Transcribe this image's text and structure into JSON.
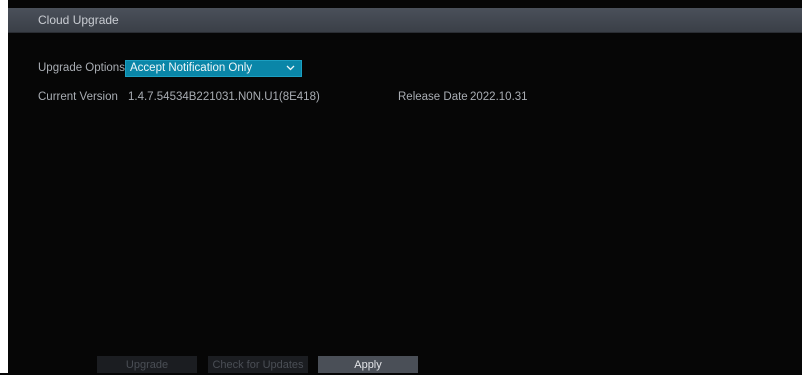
{
  "window": {
    "title": "Cloud Upgrade"
  },
  "form": {
    "upgrade_options_label": "Upgrade Options",
    "upgrade_options_value": "Accept Notification Only",
    "current_version_label": "Current Version",
    "current_version_value": "1.4.7.54534B221031.N0N.U1(8E418)",
    "release_date_label": "Release Date",
    "release_date_value": "2022.10.31"
  },
  "buttons": {
    "upgrade": "Upgrade",
    "check_updates": "Check for Updates",
    "apply": "Apply"
  },
  "colors": {
    "accent": "#0a86a8",
    "background": "#060606",
    "titlebar": "#3f444c"
  }
}
